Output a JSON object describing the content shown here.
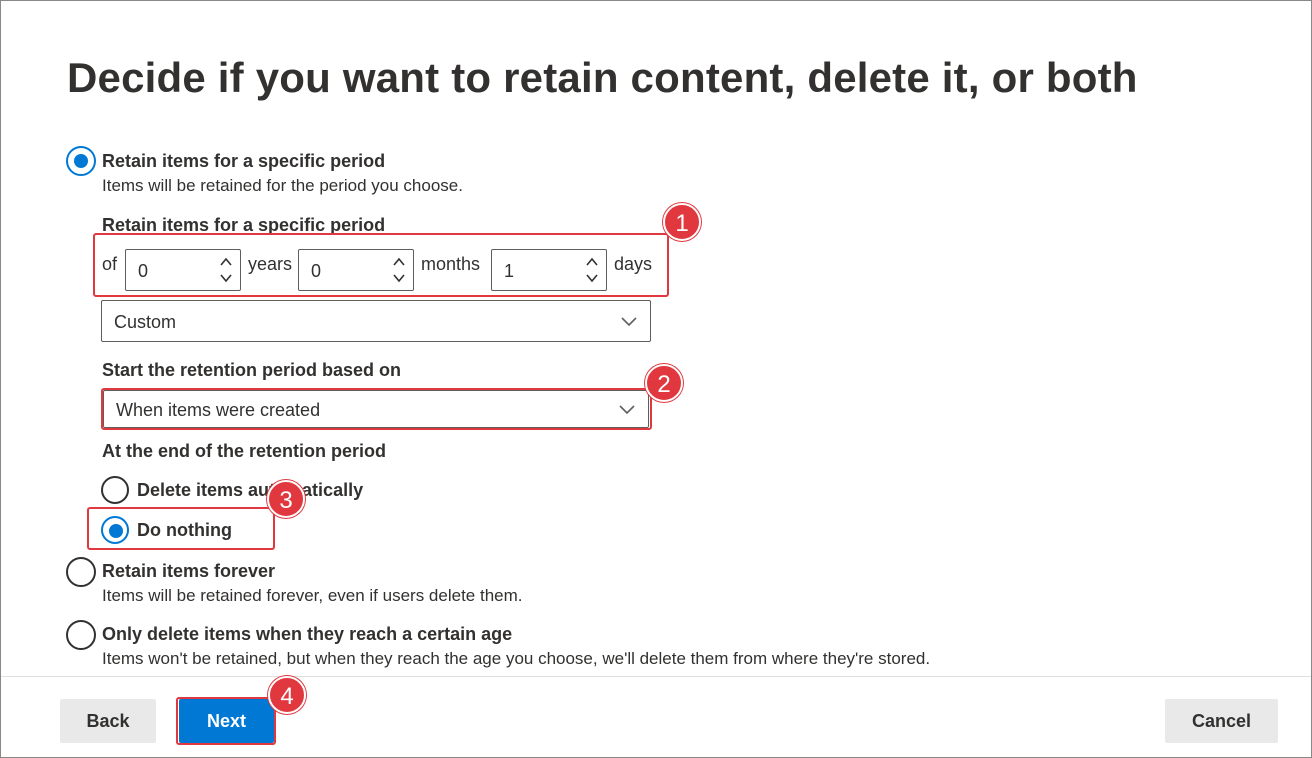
{
  "title": "Decide if you want to retain content, delete it, or both",
  "options": {
    "retain_period": {
      "label": "Retain items for a specific period",
      "description": "Items will be retained for the period you choose.",
      "selected": true
    },
    "retain_forever": {
      "label": "Retain items forever",
      "description": "Items will be retained forever, even if users delete them.",
      "selected": false
    },
    "only_delete": {
      "label": "Only delete items when they reach a certain age",
      "description": "Items won't be retained, but when they reach the age you choose, we'll delete them from where they're stored.",
      "selected": false
    }
  },
  "period": {
    "label": "Retain items for a specific period",
    "of_text": "of",
    "years_value": "0",
    "years_unit": "years",
    "months_value": "0",
    "months_unit": "months",
    "days_value": "1",
    "days_unit": "days",
    "preset_value": "Custom"
  },
  "start": {
    "label": "Start the retention period based on",
    "value": "When items were created"
  },
  "end": {
    "label": "At the end of the retention period",
    "delete_label": "Delete items automatically",
    "delete_selected": false,
    "nothing_label": "Do nothing",
    "nothing_selected": true
  },
  "callouts": [
    "1",
    "2",
    "3",
    "4"
  ],
  "footer": {
    "back_label": "Back",
    "next_label": "Next",
    "cancel_label": "Cancel"
  },
  "colors": {
    "accent": "#0078d4",
    "callout": "#e0383e",
    "text": "#323130"
  }
}
